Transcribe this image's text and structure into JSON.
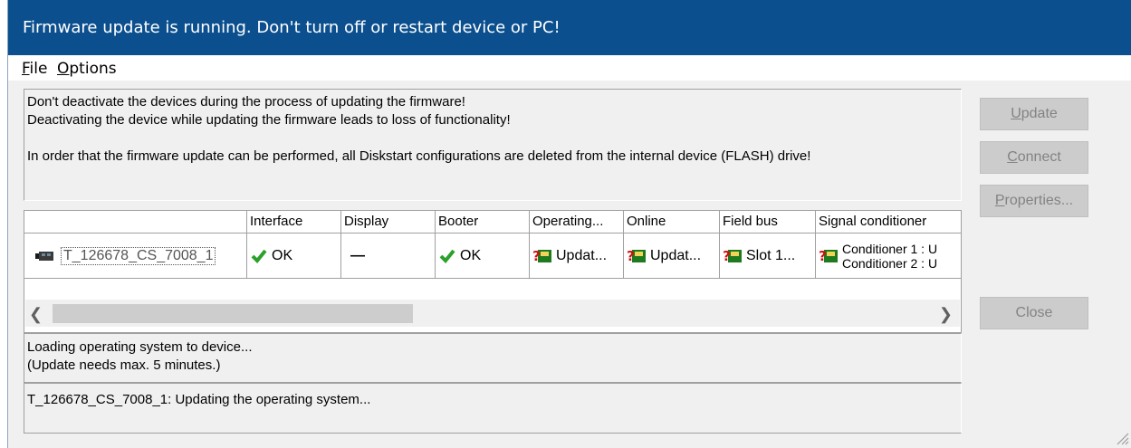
{
  "window": {
    "title": "Firmware update is running. Don't turn off or restart device or PC!"
  },
  "menu": {
    "file_prefix": "",
    "file_accel": "F",
    "file_rest": "ile",
    "options_accel": "O",
    "options_rest": "ptions"
  },
  "info": {
    "line1": "Don't deactivate the devices during the process of updating the firmware!",
    "line2": "Deactivating the device while updating the firmware leads to loss of functionality!",
    "line3": "In order that the firmware update can be performed, all Diskstart configurations are deleted from the internal device (FLASH) drive!"
  },
  "table": {
    "headers": [
      "",
      "Interface",
      "Display",
      "Booter",
      "Operating...",
      "Online",
      "Field bus",
      "Signal conditioner"
    ],
    "row": {
      "device": "T_126678_CS_7008_1",
      "interface": "OK",
      "display": "—",
      "booter": "OK",
      "operating": "Updat...",
      "online": "Updat...",
      "fieldbus": "Slot 1...",
      "conditioner1": "Conditioner 1 :  U",
      "conditioner2": "Conditioner 2 :  U"
    }
  },
  "status": {
    "line1": "Loading operating system to device...",
    "line2": "(Update needs max. 5 minutes.)",
    "log": "T_126678_CS_7008_1: Updating the operating system..."
  },
  "buttons": {
    "update_accel": "U",
    "update_rest": "pdate",
    "connect_accel": "C",
    "connect_rest": "onnect",
    "properties_accel": "P",
    "properties_rest": "roperties...",
    "close": "Close"
  },
  "colors": {
    "titlebar": "#0b4f8e",
    "check": "#2ba02b",
    "disabled_text": "#838383"
  },
  "icons": [
    "device-icon",
    "check-icon",
    "update-warning-icon",
    "resize-grip-icon"
  ]
}
